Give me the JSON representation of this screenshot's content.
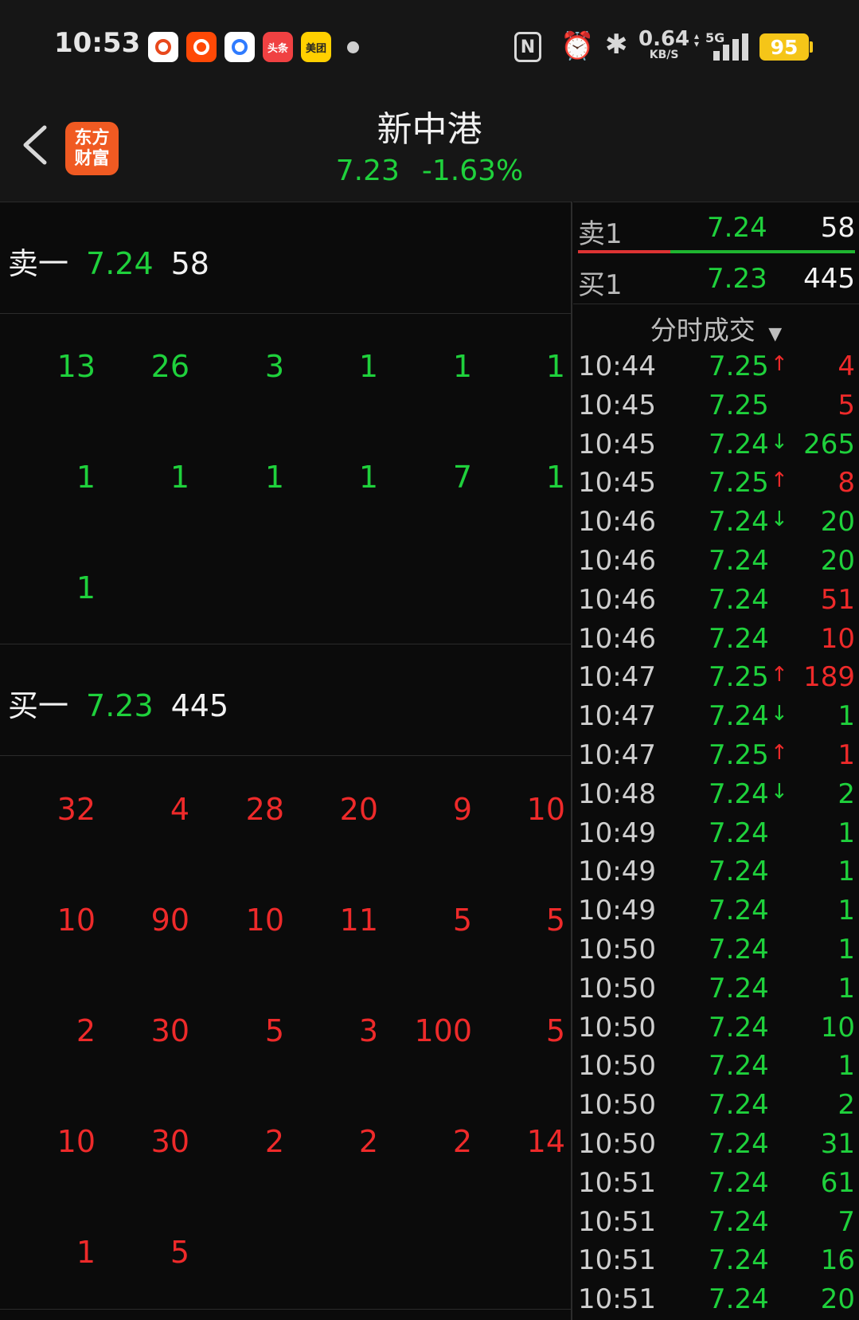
{
  "status_bar": {
    "time": "10:53",
    "apps": [
      {
        "name": "weibo-app-icon",
        "label": "",
        "bg": "#ffffff",
        "fg": "#e8481c"
      },
      {
        "name": "kuaishou-app-icon",
        "label": "",
        "bg": "#ff4906",
        "fg": "#ffffff"
      },
      {
        "name": "baidu-netdisk-app-icon",
        "label": "",
        "bg": "#ffffff",
        "fg": "#2f7bff"
      },
      {
        "name": "toutiao-app-icon",
        "label": "头条",
        "bg": "#f04142",
        "fg": "#ffffff"
      },
      {
        "name": "meituan-app-icon",
        "label": "美团",
        "bg": "#ffd000",
        "fg": "#222222"
      }
    ],
    "net_speed_value": "0.64",
    "net_speed_unit": "KB/S",
    "network_type": "5G",
    "battery": "95"
  },
  "header": {
    "logo_text": "东方财富",
    "stock_name": "新中港",
    "price": "7.23",
    "change_pct": "-1.63%"
  },
  "order_book_detail": {
    "ask": {
      "label": "卖一",
      "price": "7.24",
      "volume": "58"
    },
    "ask_orders": [
      "13",
      "26",
      "3",
      "1",
      "1",
      "1",
      "1",
      "1",
      "1",
      "1",
      "7",
      "1",
      "1"
    ],
    "bid": {
      "label": "买一",
      "price": "7.23",
      "volume": "445"
    },
    "bid_orders": [
      "32",
      "4",
      "28",
      "20",
      "9",
      "10",
      "10",
      "90",
      "10",
      "11",
      "5",
      "5",
      "2",
      "30",
      "5",
      "3",
      "100",
      "5",
      "10",
      "30",
      "2",
      "2",
      "2",
      "14",
      "1",
      "5"
    ]
  },
  "best_quotes": [
    {
      "label": "卖1",
      "price": "7.24",
      "volume": "58"
    },
    {
      "label": "买1",
      "price": "7.23",
      "volume": "445"
    }
  ],
  "ticks_title": "分时成交",
  "colors": {
    "up": "#ee2a2a",
    "down": "#1fd13c"
  },
  "ticks": [
    {
      "time": "10:44",
      "price": "7.25",
      "dir": "up",
      "volume": "4",
      "side": "buy"
    },
    {
      "time": "10:45",
      "price": "7.25",
      "dir": "",
      "volume": "5",
      "side": "buy"
    },
    {
      "time": "10:45",
      "price": "7.24",
      "dir": "down",
      "volume": "265",
      "side": "sell"
    },
    {
      "time": "10:45",
      "price": "7.25",
      "dir": "up",
      "volume": "8",
      "side": "buy"
    },
    {
      "time": "10:46",
      "price": "7.24",
      "dir": "down",
      "volume": "20",
      "side": "sell"
    },
    {
      "time": "10:46",
      "price": "7.24",
      "dir": "",
      "volume": "20",
      "side": "sell"
    },
    {
      "time": "10:46",
      "price": "7.24",
      "dir": "",
      "volume": "51",
      "side": "buy"
    },
    {
      "time": "10:46",
      "price": "7.24",
      "dir": "",
      "volume": "10",
      "side": "buy"
    },
    {
      "time": "10:47",
      "price": "7.25",
      "dir": "up",
      "volume": "189",
      "side": "buy"
    },
    {
      "time": "10:47",
      "price": "7.24",
      "dir": "down",
      "volume": "1",
      "side": "sell"
    },
    {
      "time": "10:47",
      "price": "7.25",
      "dir": "up",
      "volume": "1",
      "side": "buy"
    },
    {
      "time": "10:48",
      "price": "7.24",
      "dir": "down",
      "volume": "2",
      "side": "sell"
    },
    {
      "time": "10:49",
      "price": "7.24",
      "dir": "",
      "volume": "1",
      "side": "sell"
    },
    {
      "time": "10:49",
      "price": "7.24",
      "dir": "",
      "volume": "1",
      "side": "sell"
    },
    {
      "time": "10:49",
      "price": "7.24",
      "dir": "",
      "volume": "1",
      "side": "sell"
    },
    {
      "time": "10:50",
      "price": "7.24",
      "dir": "",
      "volume": "1",
      "side": "sell"
    },
    {
      "time": "10:50",
      "price": "7.24",
      "dir": "",
      "volume": "1",
      "side": "sell"
    },
    {
      "time": "10:50",
      "price": "7.24",
      "dir": "",
      "volume": "10",
      "side": "sell"
    },
    {
      "time": "10:50",
      "price": "7.24",
      "dir": "",
      "volume": "1",
      "side": "sell"
    },
    {
      "time": "10:50",
      "price": "7.24",
      "dir": "",
      "volume": "2",
      "side": "sell"
    },
    {
      "time": "10:50",
      "price": "7.24",
      "dir": "",
      "volume": "31",
      "side": "sell"
    },
    {
      "time": "10:51",
      "price": "7.24",
      "dir": "",
      "volume": "61",
      "side": "sell"
    },
    {
      "time": "10:51",
      "price": "7.24",
      "dir": "",
      "volume": "7",
      "side": "sell"
    },
    {
      "time": "10:51",
      "price": "7.24",
      "dir": "",
      "volume": "16",
      "side": "sell"
    },
    {
      "time": "10:51",
      "price": "7.24",
      "dir": "",
      "volume": "20",
      "side": "sell"
    }
  ]
}
